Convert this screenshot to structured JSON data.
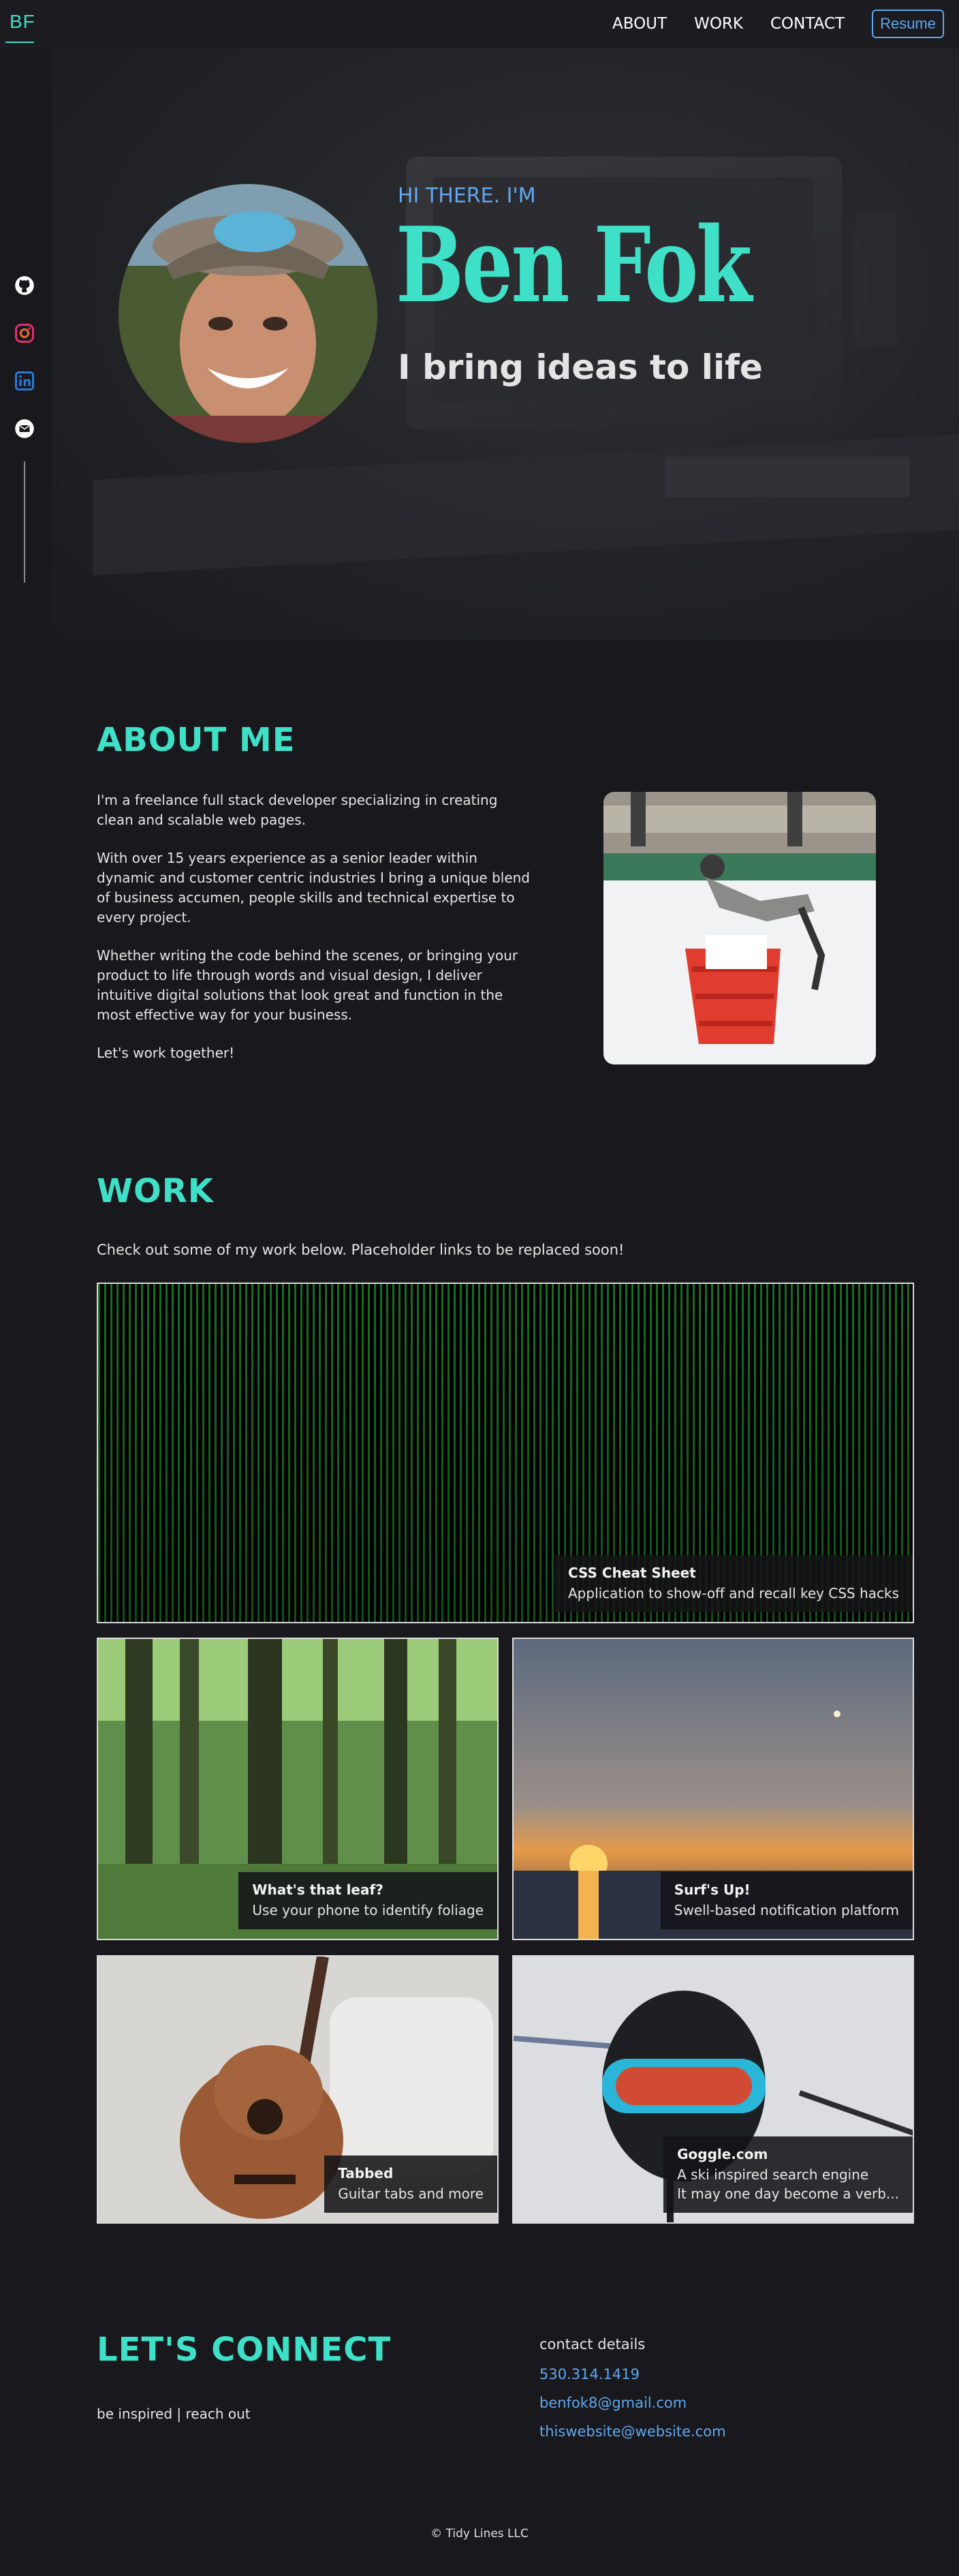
{
  "nav": {
    "logo": "BF",
    "links": [
      "ABOUT",
      "WORK",
      "CONTACT"
    ],
    "resume": "Resume"
  },
  "sidebar": {
    "icons": [
      "github-icon",
      "instagram-icon",
      "linkedin-icon",
      "email-icon"
    ]
  },
  "hero": {
    "greeting": "HI THERE. I'M",
    "name": "Ben Fok",
    "tagline": "I bring ideas to life"
  },
  "about": {
    "title": "ABOUT ME",
    "paragraphs": [
      "I'm a freelance full stack developer specializing in creating clean and scalable web pages.",
      "With over 15 years experience as a senior leader within dynamic and customer centric industries I bring a unique blend of business accumen, people skills and technical expertise to every project.",
      "Whether writing the code behind the scenes, or bringing your product to life through words and visual design, I deliver intuitive digital solutions that look great and function in the most effective way for your business.",
      "Let's work together!"
    ]
  },
  "work": {
    "title": "WORK",
    "intro": "Check out some of my work below. Placeholder links to be replaced soon!",
    "projects": [
      {
        "title": "CSS Cheat Sheet",
        "desc": "Application to show-off and recall key CSS hacks"
      },
      {
        "title": "What's that leaf?",
        "desc": "Use your phone to identify foliage"
      },
      {
        "title": "Surf's Up!",
        "desc": "Swell-based notification platform"
      },
      {
        "title": "Tabbed",
        "desc": "Guitar tabs and more"
      },
      {
        "title": "Goggle.com",
        "desc": "A ski inspired search engine\nIt may one day become a verb..."
      }
    ]
  },
  "connect": {
    "title": "LET'S CONNECT",
    "subtitle": "be inspired | reach out",
    "contact_heading": "contact details",
    "phone": "530.314.1419",
    "email": "benfok8@gmail.com",
    "website": "thiswebsite@website.com"
  },
  "footer": "© Tidy Lines LLC",
  "colors": {
    "accent": "#3ee0c7",
    "link": "#5fa8ef",
    "background": "#18181d"
  }
}
